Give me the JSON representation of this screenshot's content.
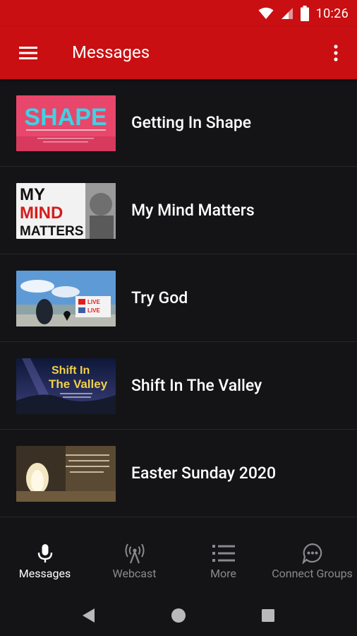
{
  "status": {
    "time": "10:26"
  },
  "appbar": {
    "title": "Messages"
  },
  "messages": [
    {
      "title": "Getting In Shape",
      "thumb_text": "SHAPE"
    },
    {
      "title": "My Mind Matters",
      "thumb_text": [
        "MY",
        "MIND",
        "MATTERS"
      ]
    },
    {
      "title": "Try God",
      "thumb_text": [
        "LIVE",
        "LIVE"
      ]
    },
    {
      "title": "Shift In The Valley",
      "thumb_text": [
        "Shift In",
        "The Valley"
      ]
    },
    {
      "title": "Easter Sunday 2020",
      "thumb_text": ""
    }
  ],
  "bottom_nav": [
    {
      "label": "Messages",
      "icon": "microphone-icon",
      "active": true
    },
    {
      "label": "Webcast",
      "icon": "broadcast-icon",
      "active": false
    },
    {
      "label": "More",
      "icon": "list-icon",
      "active": false
    },
    {
      "label": "Connect Groups",
      "icon": "chat-bubble-icon",
      "active": false
    }
  ],
  "colors": {
    "primary": "#c90f12",
    "background": "#141416",
    "inactive": "#8a8a8e"
  }
}
